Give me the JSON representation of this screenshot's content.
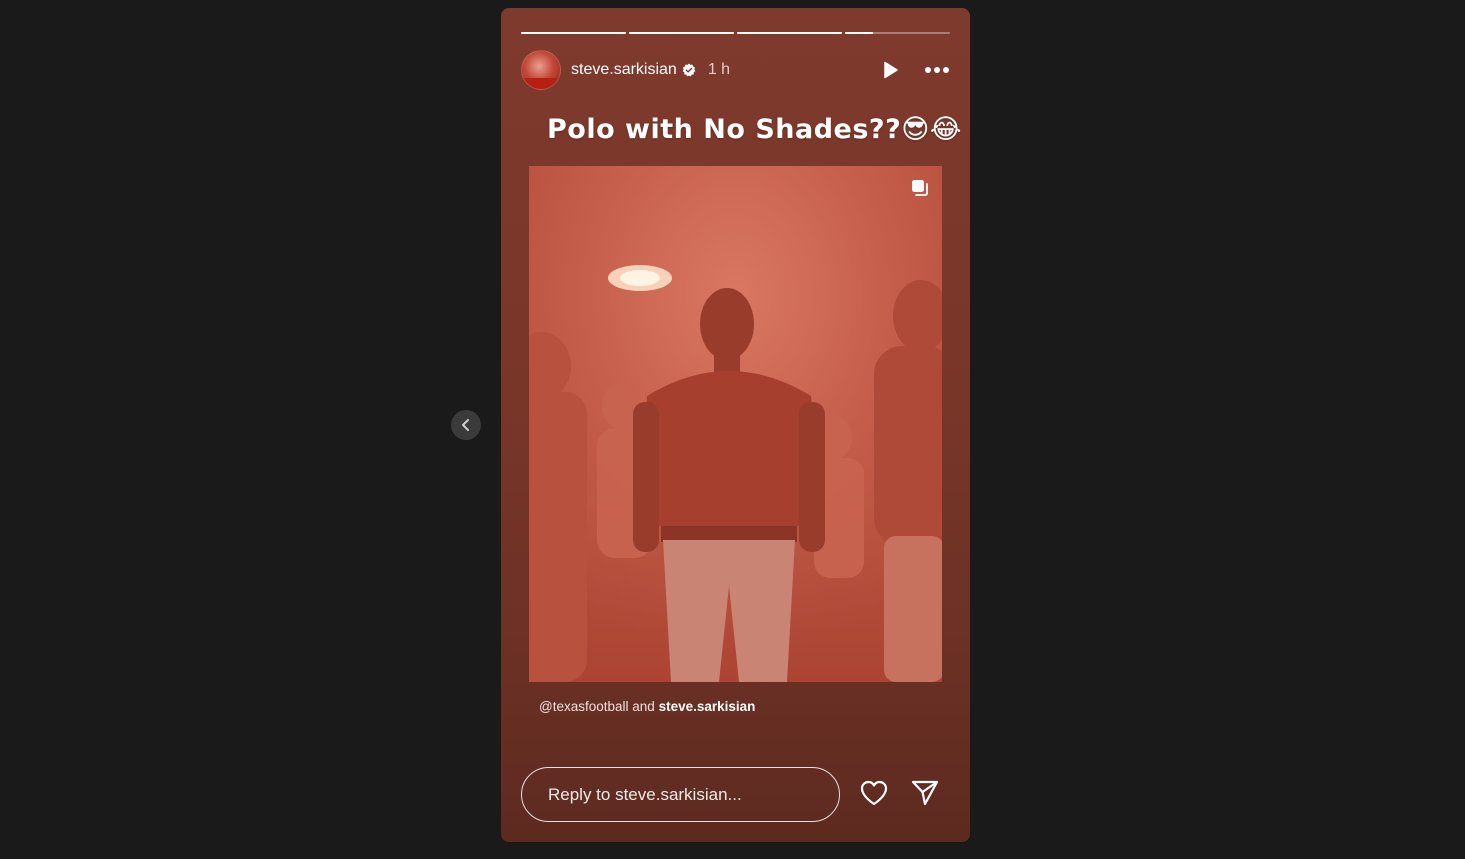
{
  "story": {
    "username": "steve.sarkisian",
    "time": "1 h",
    "progress": [
      1,
      1,
      1,
      0.27
    ],
    "caption_text": "Polo with No Shades??",
    "caption_emojis": "😎😂",
    "mention_handle": "@texasfootball",
    "mention_joiner": "and",
    "mention_user": "steve.sarkisian",
    "reply_placeholder": "Reply to steve.sarkisian..."
  },
  "icons": {
    "prev": "chevron-left-icon",
    "verified": "verified-badge-icon",
    "play": "play-icon",
    "more": "more-horizontal-icon",
    "multi": "carousel-icon",
    "like": "heart-icon",
    "share": "send-icon"
  },
  "colors": {
    "page_bg": "#1a1a1a",
    "story_bg": "#7a3729",
    "post_tint": "#c05845",
    "verified": "#ffffff"
  }
}
